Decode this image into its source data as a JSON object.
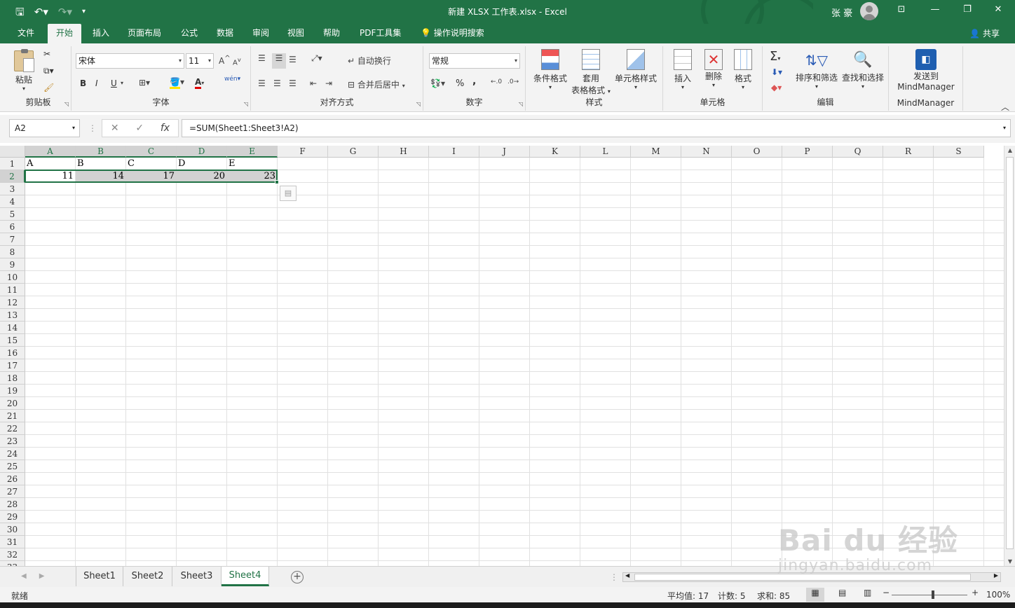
{
  "window": {
    "title": "新建 XLSX 工作表.xlsx  -  Excel",
    "user": "张 豪",
    "icons": [
      "save-icon",
      "undo-icon",
      "redo-icon",
      "customize-qat-icon",
      "ribbon-display-icon",
      "minimize-icon",
      "restore-icon",
      "close-icon"
    ]
  },
  "ribbon_tabs": [
    "文件",
    "开始",
    "插入",
    "页面布局",
    "公式",
    "数据",
    "审阅",
    "视图",
    "帮助",
    "PDF工具集"
  ],
  "tell_me": "操作说明搜索",
  "share": "共享",
  "ribbon": {
    "clipboard": {
      "label": "剪贴板",
      "paste": "粘贴"
    },
    "font": {
      "label": "字体",
      "font_name": "宋体",
      "font_size": "11",
      "bold": "B",
      "italic": "I",
      "underline": "U",
      "grow": "A",
      "phonetic": "wén"
    },
    "alignment": {
      "label": "对齐方式",
      "wrap": "自动换行",
      "merge": "合并后居中"
    },
    "number": {
      "label": "数字",
      "format": "常规",
      "percent": "%",
      "comma": ","
    },
    "styles": {
      "label": "样式",
      "conditional": "条件格式",
      "table_format_1": "套用",
      "table_format_2": "表格格式",
      "cell_styles": "单元格样式"
    },
    "cells": {
      "label": "单元格",
      "insert": "插入",
      "delete": "删除",
      "format": "格式"
    },
    "editing": {
      "label": "编辑",
      "sort_filter": "排序和筛选",
      "find_select": "查找和选择"
    },
    "mindmanager": {
      "label": "MindManager",
      "send_1": "发送到",
      "send_2": "MindManager"
    }
  },
  "formula_bar": {
    "name_box": "A2",
    "cancel": "✕",
    "enter": "✓",
    "fx": "fx",
    "formula": "=SUM(Sheet1:Sheet3!A2)"
  },
  "columns": [
    "A",
    "B",
    "C",
    "D",
    "E",
    "F",
    "G",
    "H",
    "I",
    "J",
    "K",
    "L",
    "M",
    "N",
    "O",
    "P",
    "Q",
    "R",
    "S"
  ],
  "selected_columns": [
    "A",
    "B",
    "C",
    "D",
    "E"
  ],
  "selected_row": 2,
  "row_count": 33,
  "cells": [
    {
      "ref": "A1",
      "value": "A"
    },
    {
      "ref": "B1",
      "value": "B"
    },
    {
      "ref": "C1",
      "value": "C"
    },
    {
      "ref": "D1",
      "value": "D"
    },
    {
      "ref": "E1",
      "value": "E"
    },
    {
      "ref": "A2",
      "value": "11",
      "numeric": true
    },
    {
      "ref": "B2",
      "value": "14",
      "numeric": true
    },
    {
      "ref": "C2",
      "value": "17",
      "numeric": true
    },
    {
      "ref": "D2",
      "value": "20",
      "numeric": true
    },
    {
      "ref": "E2",
      "value": "23",
      "numeric": true
    }
  ],
  "sheets": [
    "Sheet1",
    "Sheet2",
    "Sheet3",
    "Sheet4"
  ],
  "active_sheet": "Sheet4",
  "status": {
    "ready": "就绪",
    "average": "平均值: 17",
    "count": "计数: 5",
    "sum": "求和: 85",
    "zoom": "100%"
  },
  "colors": {
    "accent": "#217346",
    "selection": "#d2d2d2"
  },
  "watermark": {
    "brand": "Bai du 经验",
    "url": "jingyan.baidu.com"
  }
}
